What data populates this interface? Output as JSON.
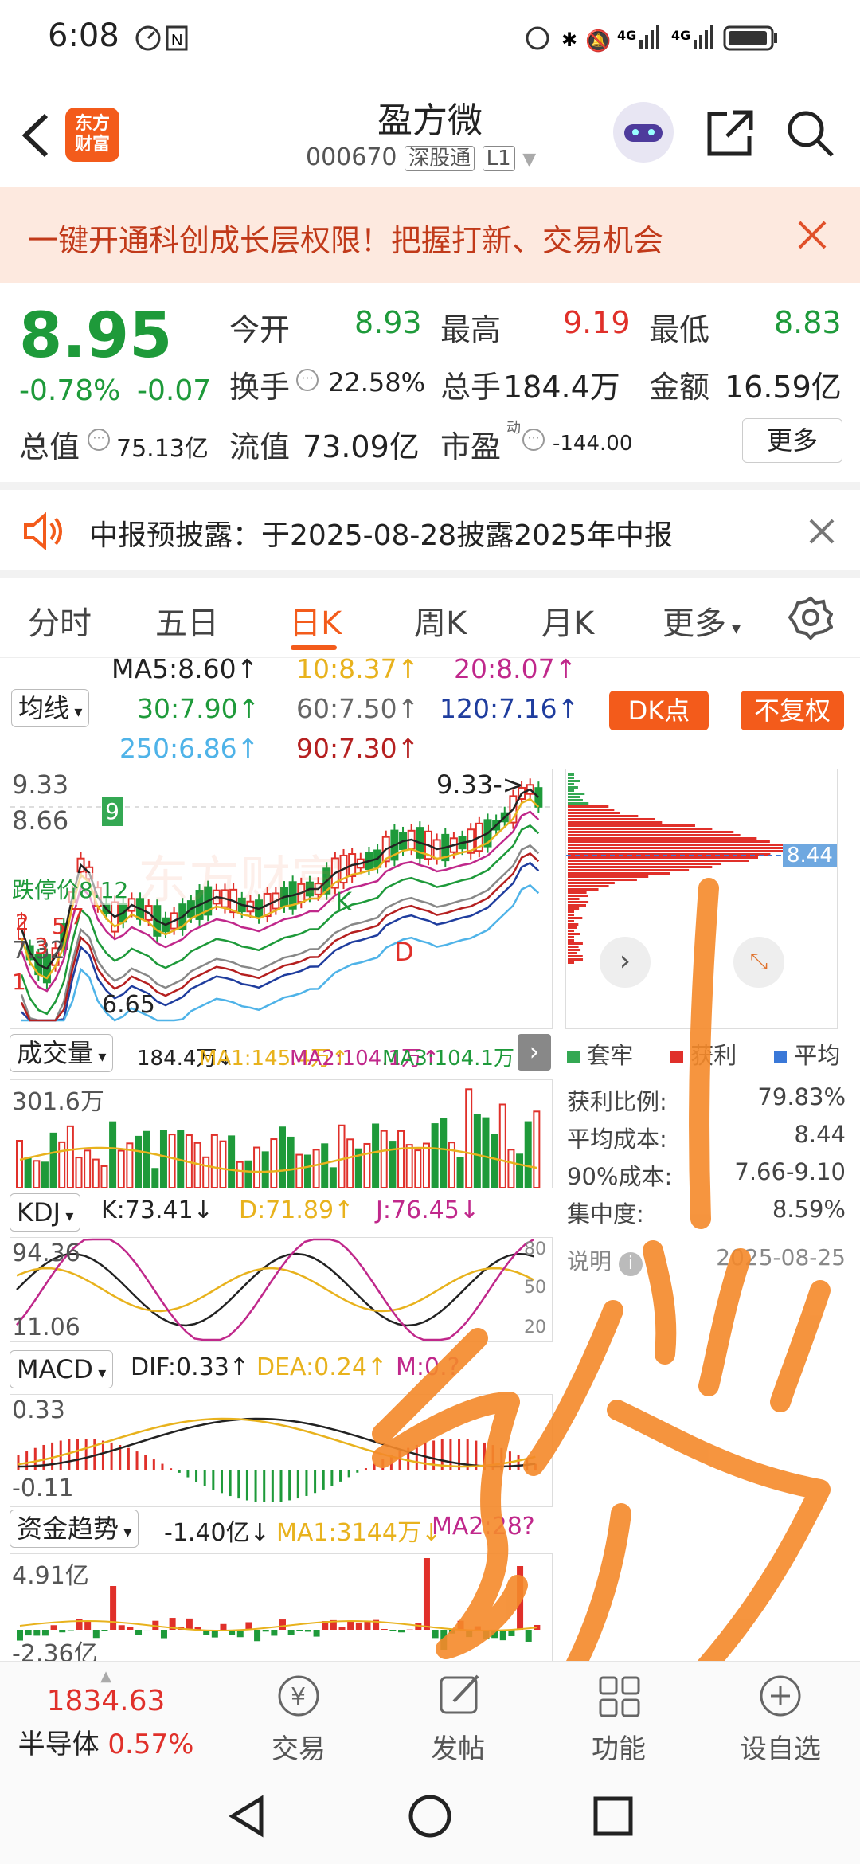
{
  "status": {
    "time": "6:08",
    "signal1": "4G",
    "signal2": "4G"
  },
  "header": {
    "logo": "东方财富",
    "title": "盈方微",
    "code": "000670",
    "tag1": "深股通",
    "tag2": "L1"
  },
  "banner": {
    "text": "一键开通科创成长层权限！把握打新、交易机会"
  },
  "quote": {
    "price": "8.95",
    "pct": "-0.78%",
    "chg": "-0.07",
    "open_label": "今开",
    "open": "8.93",
    "high_label": "最高",
    "high": "9.19",
    "low_label": "最低",
    "low": "8.83",
    "turnover_label": "换手",
    "turnover": "22.58%",
    "volume_label": "总手",
    "volume": "184.4万",
    "amount_label": "金额",
    "amount": "16.59亿",
    "mktcap_label": "总值",
    "mktcap": "75.13亿",
    "float_label": "流值",
    "float": "73.09亿",
    "pe_label": "市盈",
    "pe_sup": "动",
    "pe": "-144.00",
    "more": "更多"
  },
  "notice": {
    "text": "中报预披露：于2025-08-28披露2025年中报"
  },
  "tabs": [
    {
      "label": "分时"
    },
    {
      "label": "五日"
    },
    {
      "label": "日K"
    },
    {
      "label": "周K"
    },
    {
      "label": "月K"
    },
    {
      "label": "更多"
    }
  ],
  "ma": {
    "selector": "均线",
    "ma5": "MA5:8.60↑",
    "ma10": "10:8.37↑",
    "ma20": "20:8.07↑",
    "ma30": "30:7.90↑",
    "ma60": "60:7.50↑",
    "ma120": "120:7.16↑",
    "ma250": "250:6.86↑",
    "ma90": "90:7.30↑",
    "dk": "DK点",
    "fq": "不复权"
  },
  "kline": {
    "top": "9.33",
    "second": "8.66",
    "max_note": "9.33->",
    "limit": "跌停价8.12",
    "min_note": "6.65",
    "mid": "7.32",
    "marker_k": "K",
    "marker_d": "D",
    "marker_9": "9",
    "counts": [
      "2",
      "3",
      "5",
      "7",
      "1"
    ],
    "watermark": "东方财富"
  },
  "chip": {
    "cost_line": "8.44",
    "legend": [
      "套牢",
      "获利",
      "平均"
    ],
    "rows": [
      {
        "label": "获利比例:",
        "value": "79.83%"
      },
      {
        "label": "平均成本:",
        "value": "8.44"
      },
      {
        "label": "90%成本:",
        "value": "7.66-9.10"
      },
      {
        "label": "集中度:",
        "value": "8.59%"
      }
    ],
    "note": "说明",
    "date": "2025-08-25"
  },
  "volume": {
    "selector": "成交量",
    "v": "184.4万↓",
    "ma1": "MA1:145.4万↑",
    "ma2": "MA2:104.1万↑",
    "ma3": "MA3:104.1万↑",
    "top": "301.6万"
  },
  "kdj": {
    "selector": "KDJ",
    "k": "K:73.41↓",
    "d": "D:71.89↑",
    "j": "J:76.45↓",
    "top": "94.36",
    "bottom": "11.06",
    "r80": "80",
    "r50": "50",
    "r20": "20"
  },
  "macd": {
    "selector": "MACD",
    "dif": "DIF:0.33↑",
    "dea": "DEA:0.24↑",
    "m": "M:0.?",
    "top": "0.33",
    "bottom": "-0.11"
  },
  "fund": {
    "selector": "资金趋势",
    "v": "-1.40亿↓",
    "ma1": "MA1:3144万↓",
    "ma2": "MA2:28?",
    "top": "4.91亿",
    "bottom": "-2.36亿"
  },
  "bottombar": {
    "index_value": "1834.63",
    "index_name": "半导体",
    "index_pct": "0.57%",
    "trade": "交易",
    "post": "发帖",
    "func": "功能",
    "watch": "设自选"
  },
  "overlay_text": "",
  "colors": {
    "accent": "#f35b1b",
    "up": "#e0302a",
    "down": "#1e9a3a",
    "scribble": "#f5892a"
  }
}
